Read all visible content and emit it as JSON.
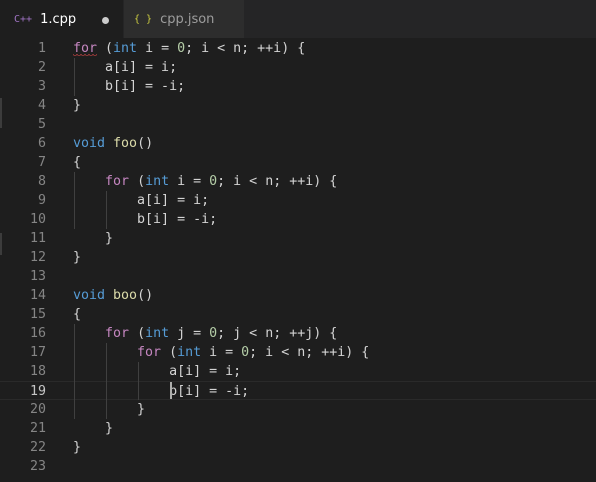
{
  "tabs": [
    {
      "icon": "C++",
      "label": "1.cpp",
      "active": true,
      "dirty": true
    },
    {
      "icon": "{ }",
      "label": "cpp.json",
      "active": false,
      "dirty": false
    }
  ],
  "colors": {
    "keyword": "#c586c0",
    "type": "#569cd6",
    "function": "#dcdcaa",
    "number": "#b5cea8",
    "text": "#d4d4d4",
    "cpp_icon": "#a074c4",
    "json_icon": "#cbcb41"
  },
  "editor": {
    "active_line": 19,
    "lines": [
      [
        [
          "kw",
          "for"
        ],
        [
          "t",
          " ("
        ],
        [
          "ty",
          "int"
        ],
        [
          "t",
          " i = "
        ],
        [
          "num",
          "0"
        ],
        [
          "t",
          "; i < n; ++i) {"
        ]
      ],
      [
        [
          "t",
          "    a[i] = i;"
        ]
      ],
      [
        [
          "t",
          "    b[i] = -i;"
        ]
      ],
      [
        [
          "t",
          "}"
        ]
      ],
      [],
      [
        [
          "ty",
          "void"
        ],
        [
          "t",
          " "
        ],
        [
          "fn",
          "foo"
        ],
        [
          "t",
          "()"
        ]
      ],
      [
        [
          "t",
          "{"
        ]
      ],
      [
        [
          "t",
          "    "
        ],
        [
          "kw",
          "for"
        ],
        [
          "t",
          " ("
        ],
        [
          "ty",
          "int"
        ],
        [
          "t",
          " i = "
        ],
        [
          "num",
          "0"
        ],
        [
          "t",
          "; i < n; ++i) {"
        ]
      ],
      [
        [
          "t",
          "        a[i] = i;"
        ]
      ],
      [
        [
          "t",
          "        b[i] = -i;"
        ]
      ],
      [
        [
          "t",
          "    }"
        ]
      ],
      [
        [
          "t",
          "}"
        ]
      ],
      [],
      [
        [
          "ty",
          "void"
        ],
        [
          "t",
          " "
        ],
        [
          "fn",
          "boo"
        ],
        [
          "t",
          "()"
        ]
      ],
      [
        [
          "t",
          "{"
        ]
      ],
      [
        [
          "t",
          "    "
        ],
        [
          "kw",
          "for"
        ],
        [
          "t",
          " ("
        ],
        [
          "ty",
          "int"
        ],
        [
          "t",
          " j = "
        ],
        [
          "num",
          "0"
        ],
        [
          "t",
          "; j < n; ++j) {"
        ]
      ],
      [
        [
          "t",
          "        "
        ],
        [
          "kw",
          "for"
        ],
        [
          "t",
          " ("
        ],
        [
          "ty",
          "int"
        ],
        [
          "t",
          " i = "
        ],
        [
          "num",
          "0"
        ],
        [
          "t",
          "; i < n; ++i) {"
        ]
      ],
      [
        [
          "t",
          "            a[i] = i;"
        ]
      ],
      [
        [
          "t",
          "            b[i] = -i;"
        ]
      ],
      [
        [
          "t",
          "        }"
        ]
      ],
      [
        [
          "t",
          "    }"
        ]
      ],
      [
        [
          "t",
          "}"
        ]
      ],
      []
    ]
  }
}
